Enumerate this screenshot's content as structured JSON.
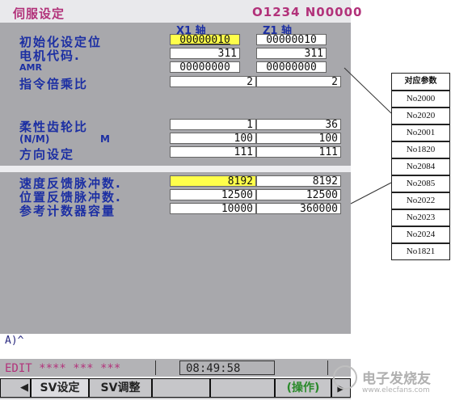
{
  "header": {
    "title": "伺服设定",
    "program": "O1234 N00000"
  },
  "axes": {
    "x1": "X1  轴",
    "z1": "Z1  轴"
  },
  "params": [
    {
      "label": "初始化设定位",
      "x": "00000010",
      "z": "00000010"
    },
    {
      "label": "电机代码.",
      "x": "311",
      "z": "311"
    },
    {
      "label": "AMR",
      "x": "00000000",
      "z": "00000000"
    },
    {
      "label": "指令倍乘比",
      "x": "2",
      "z": "2"
    },
    {
      "label": "柔性齿轮比",
      "x": "1",
      "z": "36"
    },
    {
      "label": "(N/M)",
      "label2": "M",
      "x": "100",
      "z": "100"
    },
    {
      "label": "方向设定",
      "x": "111",
      "z": "111"
    },
    {
      "label": "速度反馈脉冲数.",
      "x": "8192",
      "z": "8192"
    },
    {
      "label": "位置反馈脉冲数.",
      "x": "12500",
      "z": "12500"
    },
    {
      "label": "参考计数器容量",
      "x": "10000",
      "z": "360000"
    }
  ],
  "input_line": "A)^",
  "status": {
    "mode": "EDIT **** *** ***",
    "time": "08:49:58"
  },
  "softkeys": {
    "left_arrow": "◀",
    "sv_setting": "SV设定",
    "sv_tuning": "SV调整",
    "operation": "(操作)",
    "right_arrow": "▶"
  },
  "param_table": {
    "header": "对应参数",
    "items": [
      "No2000",
      "No2020",
      "No2001",
      "No1820",
      "No2084",
      "No2085",
      "No2022",
      "No2023",
      "No2024",
      "No1821"
    ]
  },
  "watermark": {
    "brand": "电子发烧友",
    "url": "www.elecfans.com"
  },
  "colors": {
    "screen_bg": "#a8a8ac",
    "label": "#1c2fa3",
    "header": "#b2327a",
    "highlight": "#ffff4a"
  }
}
